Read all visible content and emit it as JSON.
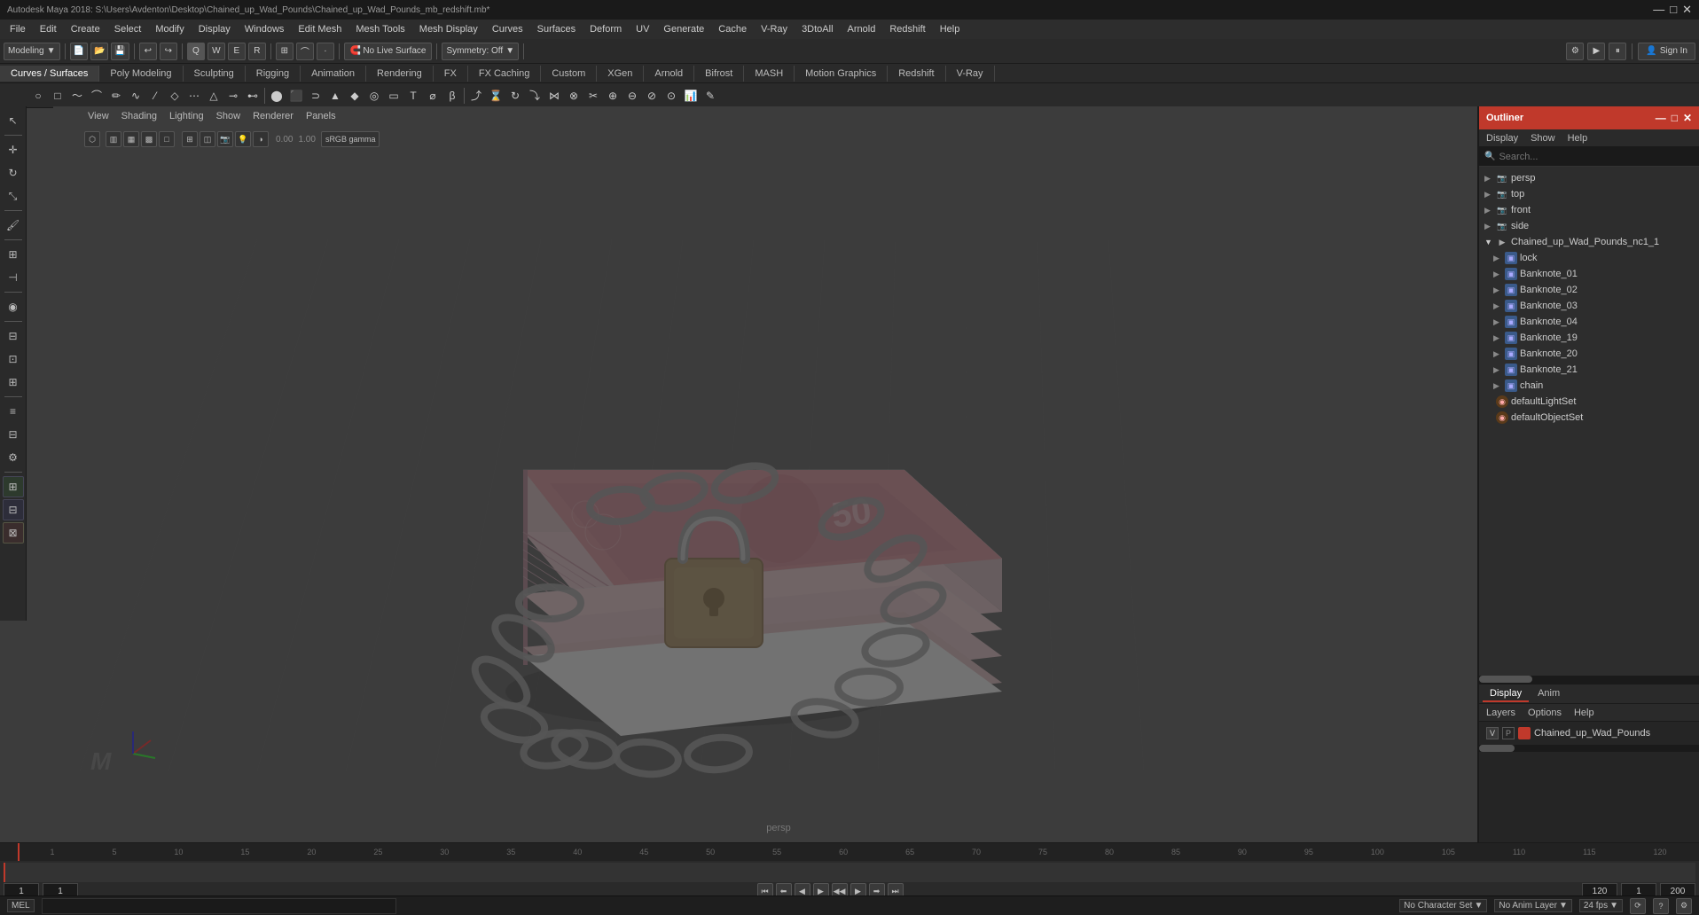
{
  "titlebar": {
    "title": "Autodesk Maya 2018: S:\\Users\\Avdenton\\Desktop\\Chained_up_Wad_Pounds\\Chained_up_Wad_Pounds_mb_redshift.mb*",
    "controls": [
      "—",
      "□",
      "✕"
    ]
  },
  "menubar": {
    "items": [
      "File",
      "Edit",
      "Create",
      "Select",
      "Modify",
      "Display",
      "Windows",
      "Edit Mesh",
      "Mesh Tools",
      "Mesh Display",
      "Curves",
      "Surfaces",
      "Deform",
      "UV",
      "Generate",
      "Cache",
      "V-Ray",
      "3DtoAll",
      "Arnold",
      "Redshift",
      "Help"
    ]
  },
  "toolbar1": {
    "mode_label": "Modeling",
    "live_surface": "No Live Surface",
    "symmetry": "Symmetry: Off",
    "sign_in": "Sign In"
  },
  "module_tabs": {
    "items": [
      "Curves / Surfaces",
      "Poly Modeling",
      "Sculpting",
      "Rigging",
      "Animation",
      "Rendering",
      "FX",
      "FX Caching",
      "Custom",
      "XGen",
      "Arnold",
      "Bifrost",
      "MASH",
      "Motion Graphics",
      "Redshift",
      "V-Ray"
    ]
  },
  "viewport": {
    "label": "persp",
    "menus": [
      "View",
      "Shading",
      "Lighting",
      "Show",
      "Renderer",
      "Panels"
    ],
    "gamma": "sRGB gamma",
    "value1": "0.00",
    "value2": "1.00"
  },
  "outliner": {
    "title": "Outliner",
    "controls": [
      "—",
      "□",
      "✕"
    ],
    "menus": [
      "Display",
      "Show",
      "Help"
    ],
    "search_placeholder": "Search...",
    "tree": [
      {
        "label": "persp",
        "indent": 0,
        "type": "camera",
        "expanded": false
      },
      {
        "label": "top",
        "indent": 0,
        "type": "camera",
        "expanded": false
      },
      {
        "label": "front",
        "indent": 0,
        "type": "camera",
        "expanded": false
      },
      {
        "label": "side",
        "indent": 0,
        "type": "camera",
        "expanded": false
      },
      {
        "label": "Chained_up_Wad_Pounds_nc1_1",
        "indent": 0,
        "type": "group",
        "expanded": true
      },
      {
        "label": "lock",
        "indent": 1,
        "type": "mesh",
        "expanded": false
      },
      {
        "label": "Banknote_01",
        "indent": 1,
        "type": "mesh",
        "expanded": false
      },
      {
        "label": "Banknote_02",
        "indent": 1,
        "type": "mesh",
        "expanded": false
      },
      {
        "label": "Banknote_03",
        "indent": 1,
        "type": "mesh",
        "expanded": false
      },
      {
        "label": "Banknote_04",
        "indent": 1,
        "type": "mesh",
        "expanded": false
      },
      {
        "label": "Banknote_19",
        "indent": 1,
        "type": "mesh",
        "expanded": false
      },
      {
        "label": "Banknote_20",
        "indent": 1,
        "type": "mesh",
        "expanded": false
      },
      {
        "label": "Banknote_21",
        "indent": 1,
        "type": "mesh",
        "expanded": false
      },
      {
        "label": "chain",
        "indent": 1,
        "type": "mesh",
        "expanded": false
      },
      {
        "label": "defaultLightSet",
        "indent": 0,
        "type": "light",
        "expanded": false
      },
      {
        "label": "defaultObjectSet",
        "indent": 0,
        "type": "set",
        "expanded": false
      }
    ]
  },
  "outliner_bottom": {
    "tabs": [
      "Display",
      "Anim"
    ],
    "active_tab": "Display",
    "sub_menus": [
      "Layers",
      "Options",
      "Help"
    ],
    "layers": [
      {
        "v": "V",
        "p": "P",
        "color": "#c0392b",
        "name": "Chained_up_Wad_Pounds"
      }
    ]
  },
  "timeline": {
    "start": "1",
    "end": "120",
    "current": "1",
    "playback_start": "1",
    "playback_end": "200",
    "fps": "24 fps",
    "ruler_ticks": [
      "1",
      "5",
      "10",
      "15",
      "20",
      "25",
      "30",
      "35",
      "40",
      "45",
      "50",
      "55",
      "60",
      "65",
      "70",
      "75",
      "80",
      "85",
      "90",
      "95",
      "100",
      "105",
      "110",
      "115",
      "120"
    ]
  },
  "statusbar": {
    "mode": "MEL",
    "no_character_set": "No Character Set",
    "no_anim_layer": "No Anim Layer",
    "fps": "24 fps"
  },
  "icons": {
    "search": "🔍",
    "expand": "▶",
    "collapse": "▼",
    "camera": "📷",
    "mesh": "▣",
    "group": "📁",
    "light": "💡",
    "set": "⚙"
  }
}
